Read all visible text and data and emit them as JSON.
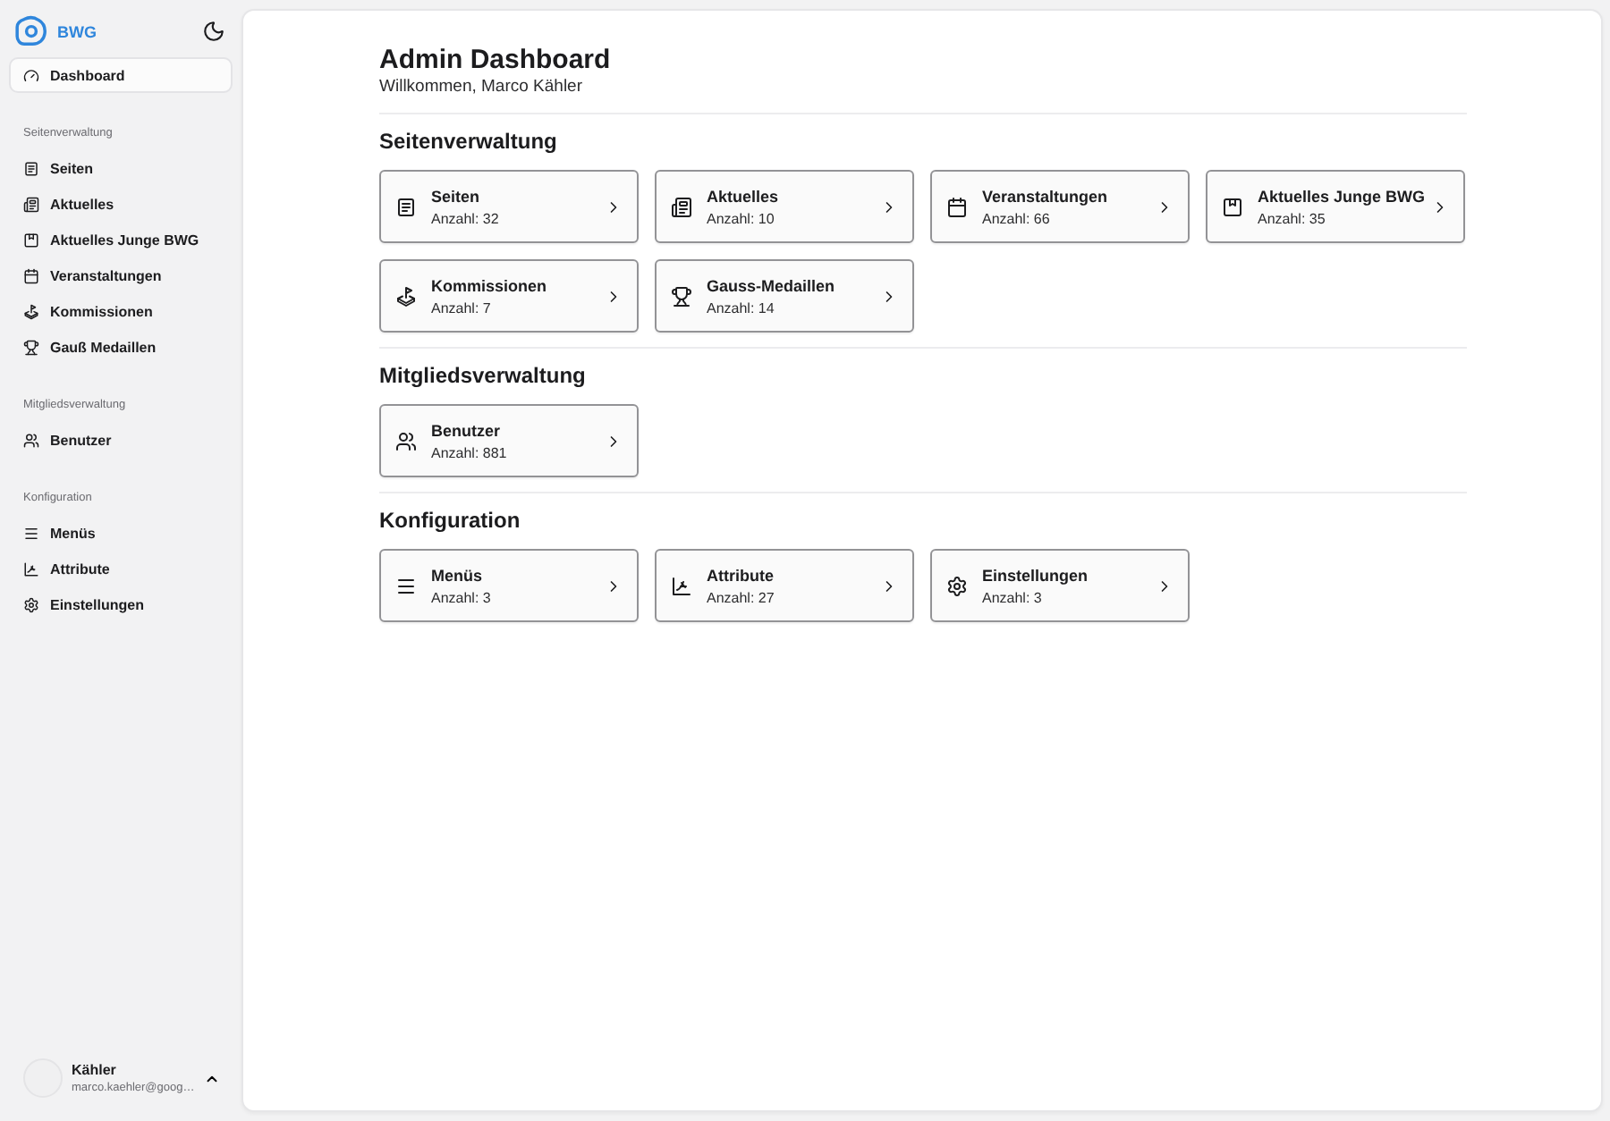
{
  "sidebar": {
    "brand": "BWG",
    "groups": [
      {
        "items": [
          {
            "label": "Dashboard",
            "selected": true
          }
        ]
      },
      {
        "title": "Seitenverwaltung",
        "items": [
          {
            "label": "Seiten",
            "selected": false
          },
          {
            "label": "Aktuelles",
            "selected": false
          },
          {
            "label": "Aktuelles Junge BWG",
            "selected": false
          },
          {
            "label": "Veranstaltungen",
            "selected": false
          },
          {
            "label": "Kommissionen",
            "selected": false
          },
          {
            "label": "Gauß Medaillen",
            "selected": false
          }
        ]
      },
      {
        "title": "Mitgliedsverwaltung",
        "items": [
          {
            "label": "Benutzer",
            "selected": false
          }
        ]
      },
      {
        "title": "Konfiguration",
        "items": [
          {
            "label": "Menüs",
            "selected": false
          },
          {
            "label": "Attribute",
            "selected": false
          },
          {
            "label": "Einstellungen",
            "selected": false
          }
        ]
      }
    ],
    "user": {
      "name": "Kähler",
      "email": "marco.kaehler@goog…"
    }
  },
  "main": {
    "title": "Admin Dashboard",
    "subtitle": "Willkommen, Marco Kähler",
    "sections": [
      {
        "heading": "Seitenverwaltung",
        "cards": [
          {
            "title": "Seiten",
            "count": "Anzahl: 32"
          },
          {
            "title": "Aktuelles",
            "count": "Anzahl: 10"
          },
          {
            "title": "Veranstaltungen",
            "count": "Anzahl: 66"
          },
          {
            "title": "Aktuelles Junge BWG",
            "count": "Anzahl: 35"
          },
          {
            "title": "Kommissionen",
            "count": "Anzahl: 7"
          },
          {
            "title": "Gauss-Medaillen",
            "count": "Anzahl: 14"
          }
        ]
      },
      {
        "heading": "Mitgliedsverwaltung",
        "cards": [
          {
            "title": "Benutzer",
            "count": "Anzahl: 881"
          }
        ]
      },
      {
        "heading": "Konfiguration",
        "cards": [
          {
            "title": "Menüs",
            "count": "Anzahl: 3"
          },
          {
            "title": "Attribute",
            "count": "Anzahl: 27"
          },
          {
            "title": "Einstellungen",
            "count": "Anzahl: 3"
          }
        ]
      }
    ]
  }
}
